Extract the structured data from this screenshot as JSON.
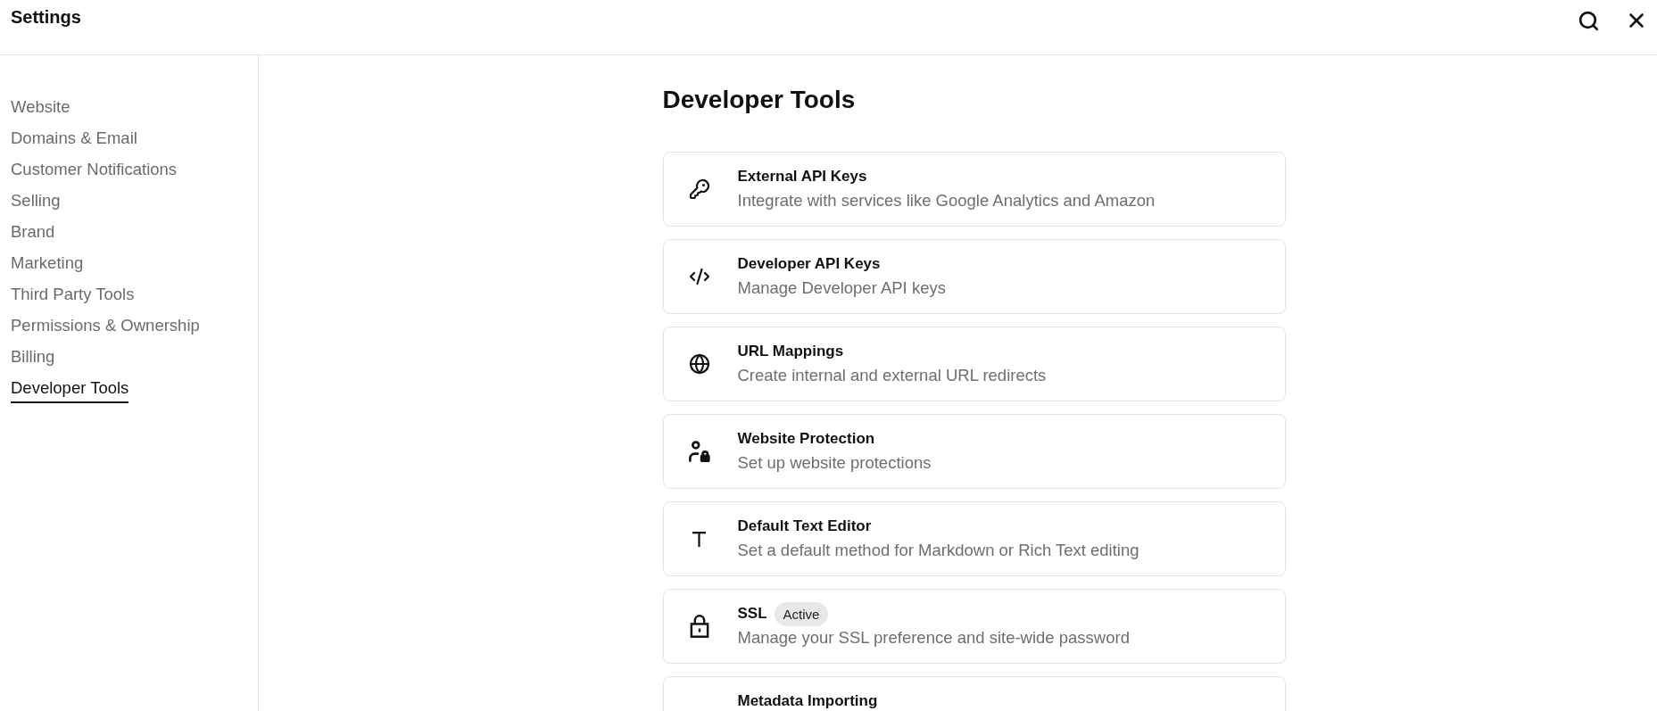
{
  "window": {
    "title": "Settings"
  },
  "sidebar": {
    "items": [
      {
        "label": "Website",
        "selected": false
      },
      {
        "label": "Domains & Email",
        "selected": false
      },
      {
        "label": "Customer Notifications",
        "selected": false
      },
      {
        "label": "Selling",
        "selected": false
      },
      {
        "label": "Brand",
        "selected": false
      },
      {
        "label": "Marketing",
        "selected": false
      },
      {
        "label": "Third Party Tools",
        "selected": false
      },
      {
        "label": "Permissions & Ownership",
        "selected": false
      },
      {
        "label": "Billing",
        "selected": false
      },
      {
        "label": "Developer Tools",
        "selected": true
      }
    ]
  },
  "page": {
    "heading": "Developer Tools",
    "cards": [
      {
        "title": "External API Keys",
        "description": "Integrate with services like Google Analytics and Amazon"
      },
      {
        "title": "Developer API Keys",
        "description": "Manage Developer API keys"
      },
      {
        "title": "URL Mappings",
        "description": "Create internal and external URL redirects"
      },
      {
        "title": "Website Protection",
        "description": "Set up website protections"
      },
      {
        "title": "Default Text Editor",
        "description": "Set a default method for Markdown or Rich Text editing"
      },
      {
        "title": "SSL",
        "badge": "Active",
        "description": "Manage your SSL preference and site-wide password"
      },
      {
        "title": "Metadata Importing"
      }
    ]
  }
}
